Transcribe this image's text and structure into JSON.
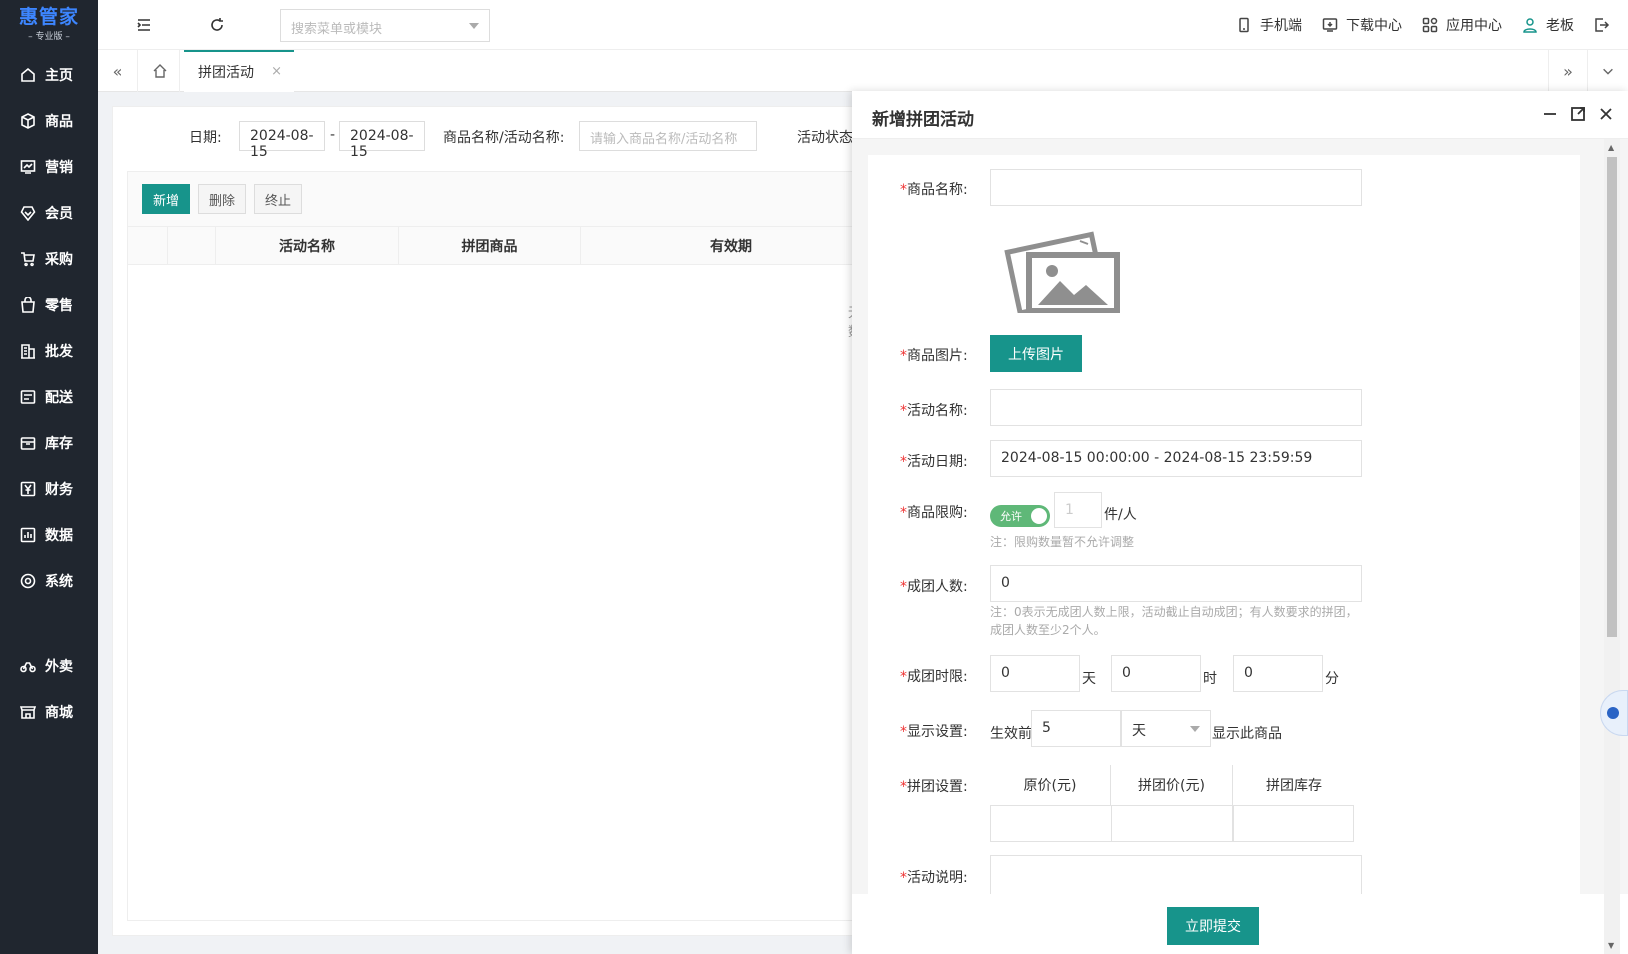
{
  "brand": {
    "name": "惠管家",
    "edition": "– 专业版 –"
  },
  "sidebar": {
    "items": [
      {
        "label": "主页",
        "icon": "home-icon"
      },
      {
        "label": "商品",
        "icon": "box-icon"
      },
      {
        "label": "营销",
        "icon": "chart-icon"
      },
      {
        "label": "会员",
        "icon": "diamond-icon"
      },
      {
        "label": "采购",
        "icon": "cart-icon"
      },
      {
        "label": "零售",
        "icon": "bag-icon"
      },
      {
        "label": "批发",
        "icon": "building-icon"
      },
      {
        "label": "配送",
        "icon": "truck-icon"
      },
      {
        "label": "库存",
        "icon": "archive-icon"
      },
      {
        "label": "财务",
        "icon": "yen-icon"
      },
      {
        "label": "数据",
        "icon": "bar-chart-icon"
      },
      {
        "label": "系统",
        "icon": "settings-icon"
      },
      {
        "label": "外卖",
        "icon": "bike-icon"
      },
      {
        "label": "商城",
        "icon": "store-icon"
      }
    ]
  },
  "topbar": {
    "search_placeholder": "搜索菜单或模块",
    "links": [
      {
        "label": "手机端",
        "icon": "mobile-icon"
      },
      {
        "label": "下载中心",
        "icon": "download-icon"
      },
      {
        "label": "应用中心",
        "icon": "apps-icon"
      },
      {
        "label": "老板",
        "icon": "user-icon"
      }
    ]
  },
  "tabs": {
    "active": "拼团活动",
    "close": "×"
  },
  "filter": {
    "date_label": "日期:",
    "date_start": "2024-08-15",
    "date_sep": "-",
    "date_end": "2024-08-15",
    "name_label": "商品名称/活动名称:",
    "name_placeholder": "请输入商品名称/活动名称",
    "status_label": "活动状态"
  },
  "toolbar": {
    "add": "新增",
    "delete": "删除",
    "stop": "终止"
  },
  "table": {
    "columns": [
      "活动名称",
      "拼团商品",
      "有效期"
    ],
    "empty": "无数"
  },
  "panel": {
    "title": "新增拼团活动",
    "fields": {
      "product_name": "商品名称:",
      "product_image": "商品图片:",
      "upload": "上传图片",
      "activity_name": "活动名称:",
      "activity_date": "活动日期:",
      "activity_date_value": "2024-08-15 00:00:00 - 2024-08-15 23:59:59",
      "limit": "商品限购:",
      "limit_toggle": "允许",
      "limit_value": "1",
      "limit_unit": "件/人",
      "limit_note": "注：限购数量暂不允许调整",
      "group_size": "成团人数:",
      "group_size_value": "0",
      "group_size_note": "注：0表示无成团人数上限，活动截止自动成团；有人数要求的拼团，成团人数至少2个人。",
      "time_limit": "成团时限:",
      "days": "0",
      "days_unit": "天",
      "hours": "0",
      "hours_unit": "时",
      "minutes": "0",
      "minutes_unit": "分",
      "display": "显示设置:",
      "display_prefix": "生效前",
      "display_value": "5",
      "display_unit": "天",
      "display_suffix": "显示此商品",
      "group_setting": "拼团设置:",
      "grid_cols": [
        "原价(元)",
        "拼团价(元)",
        "拼团库存"
      ],
      "description": "活动说明:"
    },
    "submit": "立即提交"
  }
}
